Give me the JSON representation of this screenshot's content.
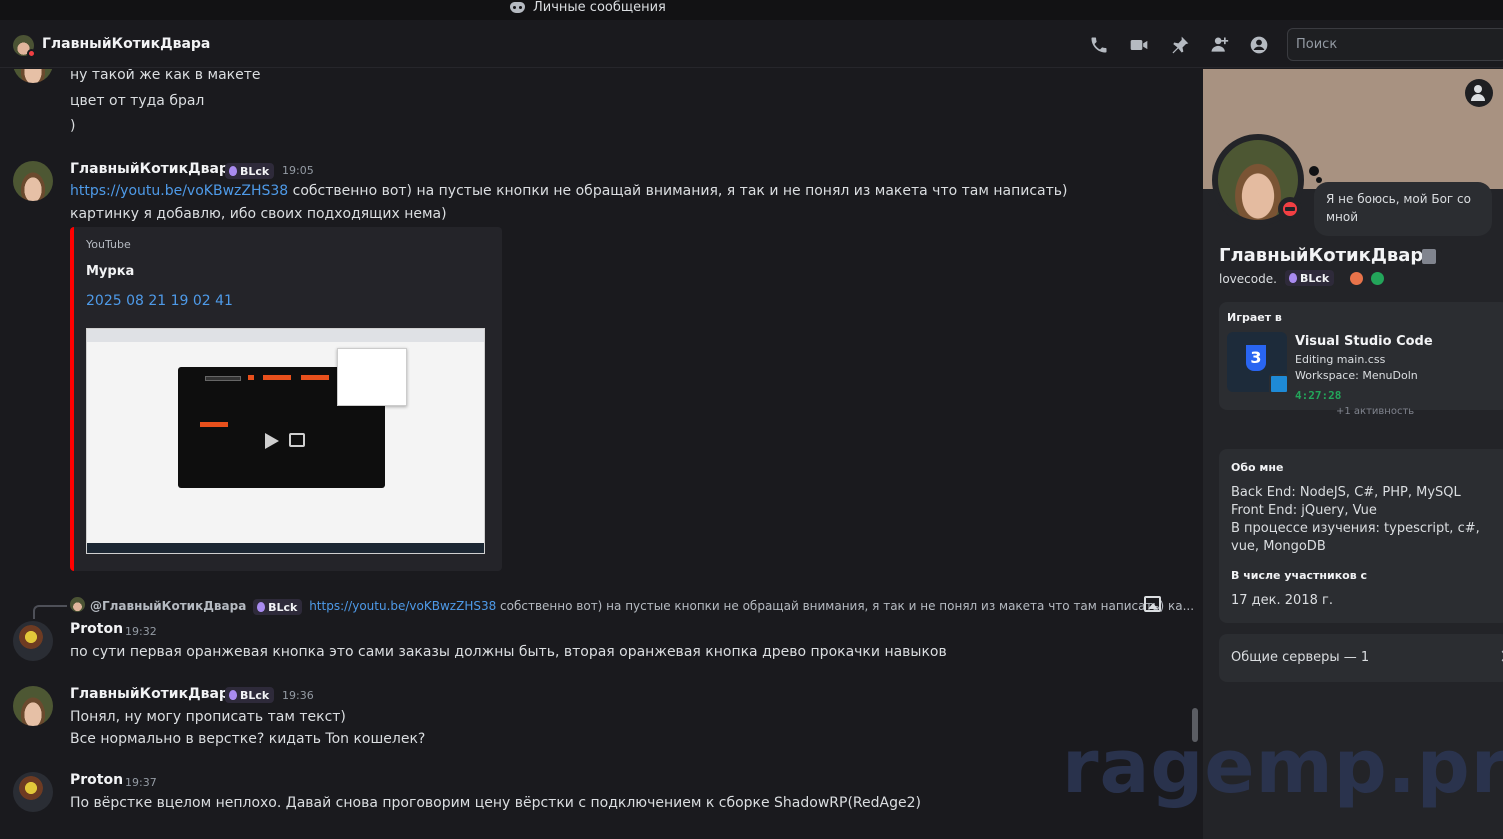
{
  "window": {
    "title": "Личные сообщения"
  },
  "header": {
    "name": "ГлавныйКотикДвара",
    "search_placeholder": "Поиск",
    "icons": [
      "voice-call-icon",
      "video-call-icon",
      "pin-icon",
      "add-friend-icon",
      "user-profile-icon"
    ]
  },
  "messages": {
    "m0": {
      "lines": [
        "ну такой же как в макете",
        "цвет от туда брал",
        ")"
      ]
    },
    "m1": {
      "author": "ГлавныйКотикДвара",
      "tag": "BLck",
      "time": "19:05",
      "link": "https://youtu.be/voKBwzZHS38",
      "line1_rest": " собственно вот) на пустые кнопки не обращай внимания, я так и не понял из макета что там написать)",
      "line2": "картинку я добавлю, ибо своих подходящих нема)",
      "embed": {
        "provider": "YouTube",
        "title": "Мурка",
        "subtitle": "2025 08 21 19 02 41"
      }
    },
    "reply": {
      "name": "@ГлавныйКотикДвара",
      "tag": "BLck",
      "link": "https://youtu.be/voKBwzZHS38",
      "rest": " собственно вот) на пустые кнопки не обращай внимания, я так и не понял из макета что там написать) ка..."
    },
    "m2": {
      "author": "Proton",
      "time": "19:32",
      "line1": "по сути первая оранжевая кнопка это сами заказы должны быть, вторая оранжевая кнопка древо прокачки навыков"
    },
    "m3": {
      "author": "ГлавныйКотикДвара",
      "tag": "BLck",
      "time": "19:36",
      "line1": "Понял, ну могу прописать там текст)",
      "line2": "Все нормально в верстке? кидать Ton кошелек?"
    },
    "m4": {
      "author": "Proton",
      "time": "19:37",
      "line1": "По вёрстке вцелом неплохо. Давай снова проговорим цену вёрстки с подключением к сборке ShadowRP(RedAge2)"
    }
  },
  "profile": {
    "status_bubble": "Я не боюсь, мой Бог со мной",
    "display_name": "ГлавныйКотикДвара",
    "username": "lovecode.",
    "tag": "BLck",
    "activity": {
      "label": "Играет в",
      "app": "Visual Studio Code",
      "details": "Editing main.css",
      "state": "Workspace: MenuDoln",
      "elapsed": "4:27:28",
      "more": "+1 активность"
    },
    "about": {
      "heading": "Обо мне",
      "lines": [
        "Back End: NodeJS, C#, PHP, MySQL",
        "Front End: jQuery, Vue",
        "В процессе изучения: typescript, c#, vue, MongoDB"
      ],
      "member_heading": "В числе участников с",
      "member_since": "17 дек. 2018 г."
    },
    "mutual_servers": "Общие серверы — 1"
  },
  "watermark": "ragemp.pro",
  "colors": {
    "accent_link": "#4e9ae8",
    "dnd_red": "#f23f43",
    "online_green": "#23a55a",
    "youtube_red": "#ff0000"
  }
}
